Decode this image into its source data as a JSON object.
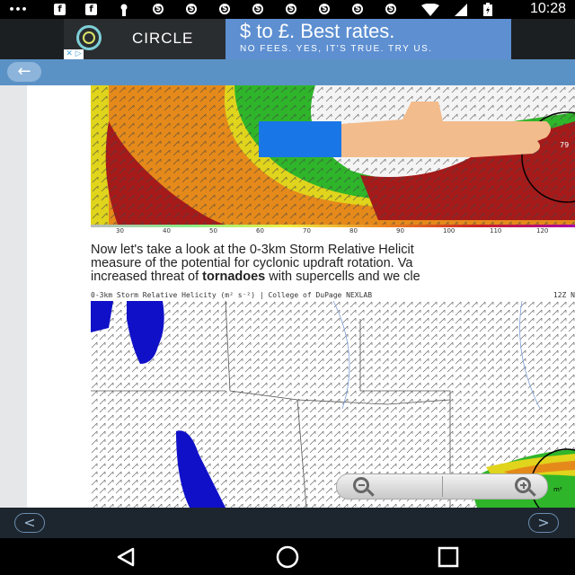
{
  "status_bar": {
    "time": "10:28",
    "icons": [
      "more-icon",
      "facebook-icon",
      "facebook-icon",
      "keyhole-icon",
      "dollar-icon",
      "dollar-icon",
      "dollar-icon",
      "dollar-icon",
      "dollar-icon",
      "dollar-icon",
      "dollar-icon",
      "wifi-icon",
      "signal-icon",
      "battery-icon"
    ]
  },
  "ad": {
    "brand": "CIRCLE",
    "headline": "$ to £. Best rates.",
    "tagline": "NO FEES. YES, IT'S TRUE. TRY US.",
    "choices": "✕ ▷",
    "colors": {
      "left_bg": "#2a2d30",
      "right_bg": "#5d8fd1"
    }
  },
  "header": {
    "back_icon": "←"
  },
  "map1": {
    "scale_labels": [
      "30",
      "40",
      "50",
      "60",
      "70",
      "80",
      "90",
      "100",
      "110",
      "120"
    ],
    "marker": "79"
  },
  "article": {
    "line1": "Now let's take a look at the 0-3km Storm Relative Helicit",
    "line2": "measure of the potential for cyclonic updraft rotation. Va",
    "line3_pre": "increased threat of ",
    "line3_bold": "tornadoes",
    "line3_post": " with supercells and we cle"
  },
  "map2": {
    "title": "0-3km Storm Relative Helicity (m² s⁻²) | College of DuPage NEXLAB",
    "title_right": "12Z N",
    "corner_label": "m²"
  },
  "zoom": {
    "out_label": "zoom out",
    "in_label": "zoom in"
  },
  "pagebar": {
    "prev": "<",
    "next": ">"
  },
  "colors": {
    "header": "#5b92c6",
    "pagebar": "#1d262e"
  }
}
